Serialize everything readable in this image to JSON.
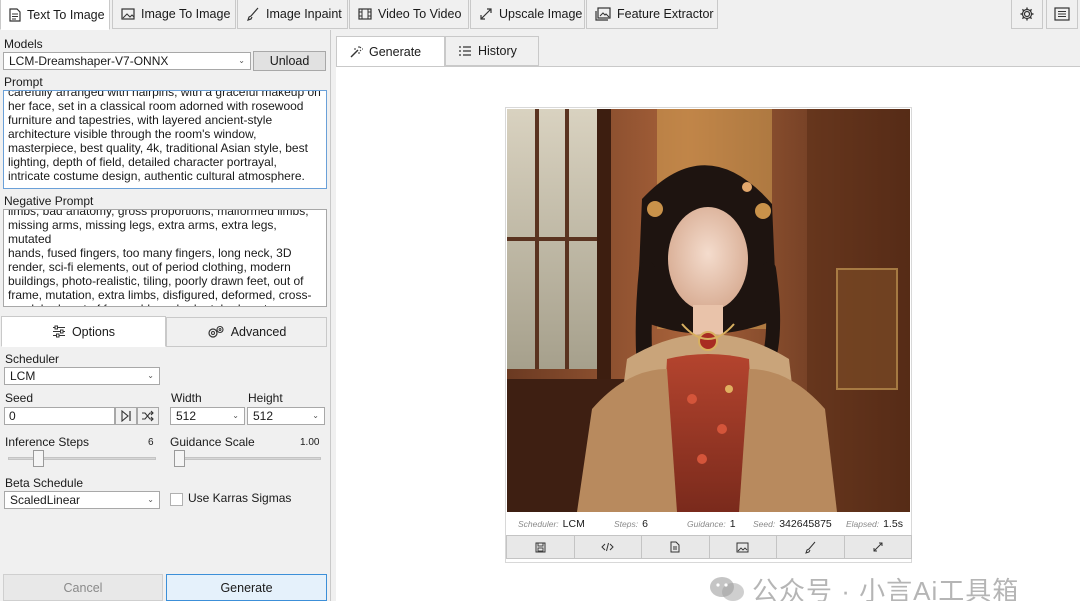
{
  "tabs": [
    {
      "label": "Text To Image",
      "icon": "document-icon"
    },
    {
      "label": "Image To Image",
      "icon": "image-icon"
    },
    {
      "label": "Image Inpaint",
      "icon": "brush-icon"
    },
    {
      "label": "Video To Video",
      "icon": "film-icon"
    },
    {
      "label": "Upscale Image",
      "icon": "expand-icon"
    },
    {
      "label": "Feature Extractor",
      "icon": "gallery-icon"
    }
  ],
  "active_tab": "Text To Image",
  "toolbar_icons": [
    "settings-icon",
    "list-icon"
  ],
  "models": {
    "label": "Models",
    "selected": "LCM-Dreamshaper-V7-ONNX",
    "unload_label": "Unload"
  },
  "prompt": {
    "label": "Prompt",
    "value": "carefully arranged with hairpins, with a graceful makeup on\nher face, set in a classical room adorned with rosewood\nfurniture and tapestries, with layered ancient-style\narchitecture visible through the room's window,\nmasterpiece, best quality, 4k, traditional Asian style, best\nlighting, depth of field, detailed character portrayal,\nintricate costume design, authentic cultural atmosphere."
  },
  "negative_prompt": {
    "label": "Negative Prompt",
    "value": "limbs, bad anatomy, gross proportions, malformed limbs,\nmissing arms, missing legs, extra arms, extra legs, mutated\nhands, fused fingers, too many fingers, long neck, 3D\nrender, sci-fi elements, out of period clothing, modern\nbuildings, photo-realistic, tiling, poorly drawn feet, out of\nframe, mutation, extra limbs, disfigured, deformed, cross-\neyed, body out of frame, blurry, bad art, bad anatomy"
  },
  "options_tabs": {
    "options_label": "Options",
    "advanced_label": "Advanced"
  },
  "options": {
    "scheduler_label": "Scheduler",
    "scheduler_value": "LCM",
    "seed_label": "Seed",
    "seed_value": "0",
    "width_label": "Width",
    "width_value": "512",
    "height_label": "Height",
    "height_value": "512",
    "steps_label": "Inference Steps",
    "steps_value": "6",
    "steps_fraction": 0.1,
    "guidance_label": "Guidance Scale",
    "guidance_value": "1.00",
    "guidance_fraction": 0.0,
    "beta_label": "Beta Schedule",
    "beta_value": "ScaledLinear",
    "karras_label": "Use Karras Sigmas",
    "karras_checked": false
  },
  "buttons": {
    "cancel_label": "Cancel",
    "generate_label": "Generate"
  },
  "right_tabs": {
    "generate_label": "Generate",
    "history_label": "History"
  },
  "result": {
    "scheduler_key": "Scheduler:",
    "scheduler_val": "LCM",
    "steps_key": "Steps:",
    "steps_val": "6",
    "guidance_key": "Guidance:",
    "guidance_val": "1",
    "seed_key": "Seed:",
    "seed_val": "342645875",
    "elapsed_key": "Elapsed:",
    "elapsed_val": "1.5s",
    "actions": [
      "save-icon",
      "code-icon",
      "document-icon",
      "image-icon",
      "brush-icon",
      "expand-icon"
    ]
  },
  "watermark": "公众号 · 小言Ai工具箱"
}
